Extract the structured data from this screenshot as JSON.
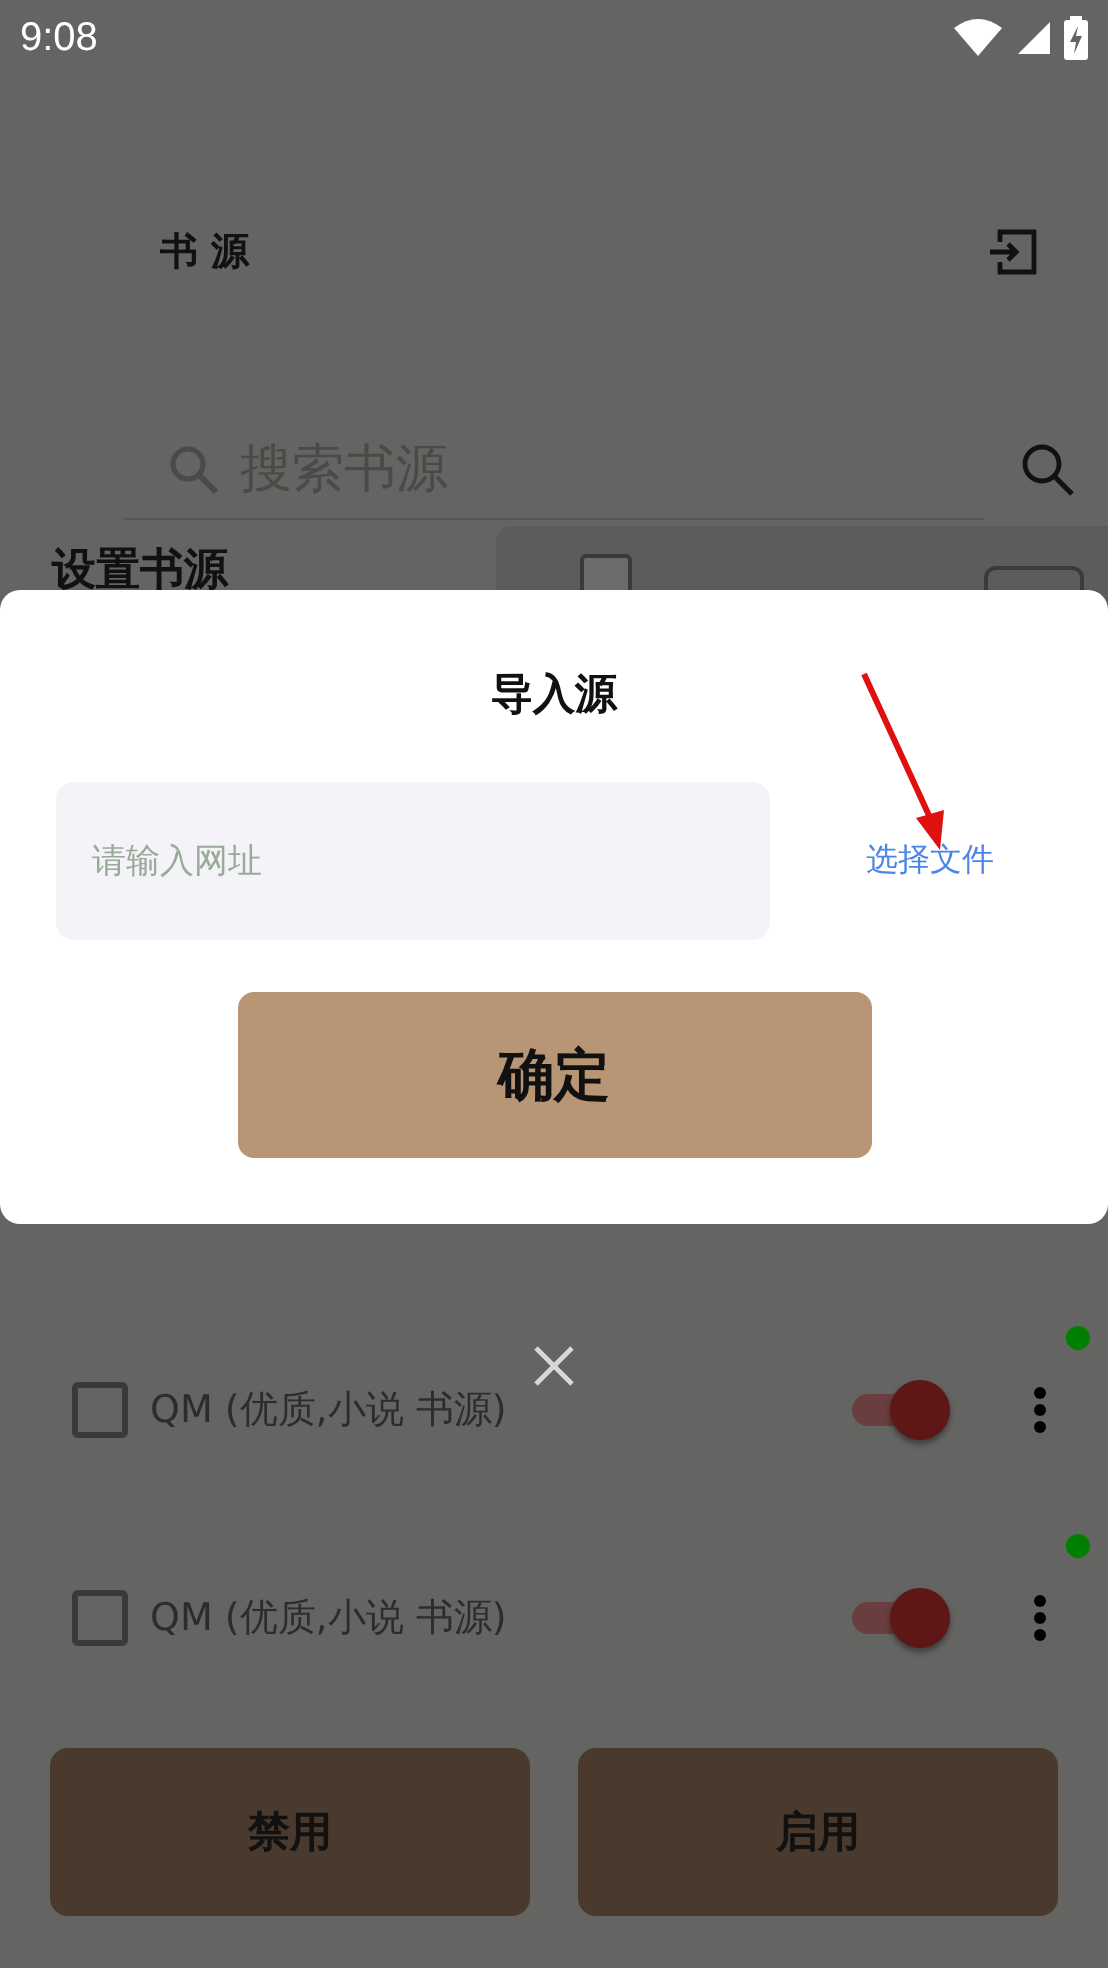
{
  "status_bar": {
    "time": "9:08"
  },
  "header": {
    "title": "书 源"
  },
  "search": {
    "placeholder": "搜索书源"
  },
  "section": {
    "title": "设置书源"
  },
  "dialog": {
    "title": "导入源",
    "url_field": {
      "placeholder": "请输入网址"
    },
    "file_link": "选择文件",
    "confirm": "确定"
  },
  "sources": [
    {
      "name": "QM (优质,小说 书源)",
      "checked": false,
      "enabled": true,
      "color": "#008000"
    },
    {
      "name": "QM (优质,小说 书源)",
      "checked": false,
      "enabled": true,
      "color": "#008000"
    }
  ],
  "actions": [
    "禁用",
    "启用"
  ]
}
